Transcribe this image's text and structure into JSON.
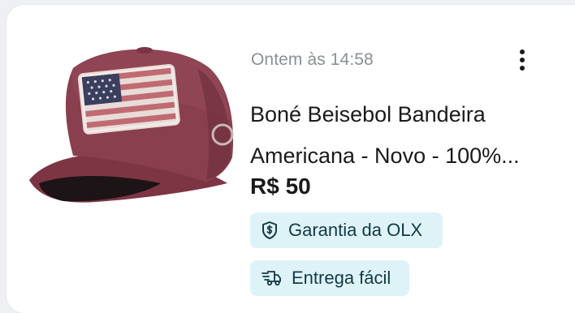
{
  "listing": {
    "timestamp": "Ontem às 14:58",
    "title_line1": "Boné Beisebol Bandeira",
    "title_line2": "Americana - Novo - 100%...",
    "price": "R$ 50",
    "image_alt": "Boné vinho com bandeira americana"
  },
  "badges": {
    "garantia": {
      "label": "Garantia da OLX",
      "icon": "shield-dollar-icon"
    },
    "entrega": {
      "label": "Entrega fácil",
      "icon": "delivery-truck-icon"
    }
  },
  "menu": {
    "icon": "kebab-menu-icon"
  },
  "colors": {
    "badge_bg": "#def3f8",
    "badge_text": "#123a44",
    "cap": "#8a3f4e",
    "timestamp": "#8a8f98"
  }
}
